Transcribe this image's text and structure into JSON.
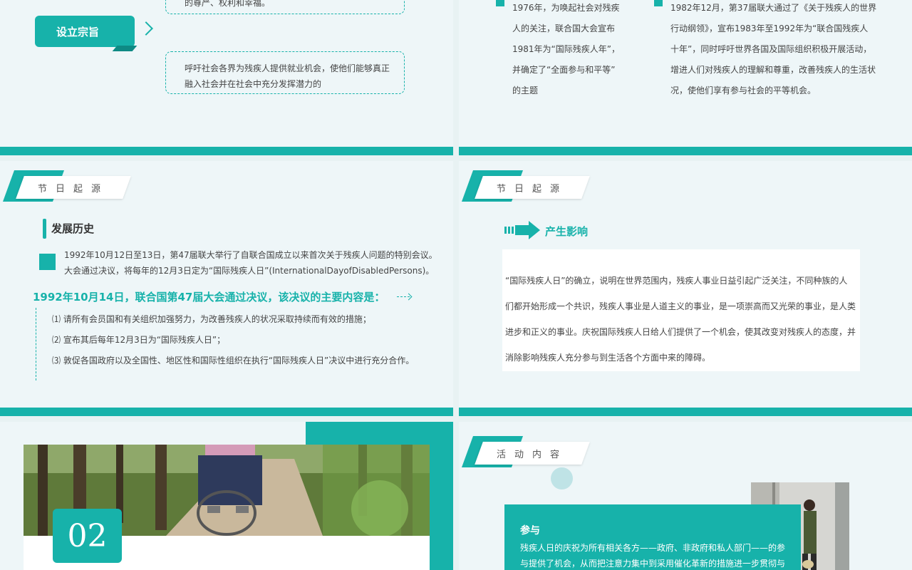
{
  "slide1": {
    "box_top_text": "的尊严、权利和幸福。",
    "tag_label": "设立宗旨",
    "box_bottom_text": "呼吁社会各界为残疾人提供就业机会，使他们能够真正融入社会并在社会中充分发挥潜力的"
  },
  "slide2": {
    "col1_lines": [
      "1976年，为唤起社会对残疾",
      "人的关注，联合国大会宣布",
      "1981年为“国际残疾人年”，",
      "并确定了“全面参与和平等”",
      "的主题"
    ],
    "col2_lines": [
      "1982年12月，第37届联大通过了《关于残疾人的世界",
      "行动纲领》，宣布1983年至1992年为“联合国残疾人",
      "十年”，同时呼吁世界各国及国际组织积极开展活动，",
      "增进人们对残疾人的理解和尊重，改善残疾人的生活状",
      "况，使他们享有参与社会的平等机会。"
    ]
  },
  "slide3": {
    "header": "节日起源",
    "title": "发展历史",
    "para_lines": [
      "1992年10月12日至13日，第47届联大举行了自联合国成立以来首次关于残疾人问题的特别会议。",
      "大会通过决议，将每年的12月3日定为“国际残疾人日”(InternationalDayofDisabledPersons)。"
    ],
    "headline": "1992年10月14日，联合国第47届大会通过决议，该决议的主要内容是：",
    "list": [
      "⑴ 请所有会员国和有关组织加强努力，为改善残疾人的状况采取持续而有效的措施；",
      "⑵ 宣布其后每年12月3日为“国际残疾人日”；",
      "⑶ 敦促各国政府以及全国性、地区性和国际性组织在执行“国际残疾人日”决议中进行充分合作。"
    ]
  },
  "slide4": {
    "header": "节日起源",
    "title": "产生影响",
    "card_lines": [
      "“国际残疾人日”的确立，说明在世界范围内，残疾人事业日益引起广泛关注，不同种族的人",
      "们都开始形成一个共识，残疾人事业是人道主义的事业，是一项崇高而又光荣的事业，是人类",
      "进步和正义的事业。庆祝国际残疾人日给人们提供了一个机会，使其改变对残疾人的态度，并",
      "消除影响残疾人充分参与到生活各个方面中来的障碍。"
    ]
  },
  "slide5": {
    "number": "02"
  },
  "slide6": {
    "header": "活动内容",
    "box_title": "参与",
    "box_lines": [
      "残疾人日的庆祝为所有相关各方——政府、非政府和私人部门——的参",
      "与提供了机会，从而把注意力集中到采用催化革新的措施进一步贯彻与"
    ]
  },
  "colors": {
    "accent": "#17b2aa",
    "background": "#eef6f8"
  }
}
